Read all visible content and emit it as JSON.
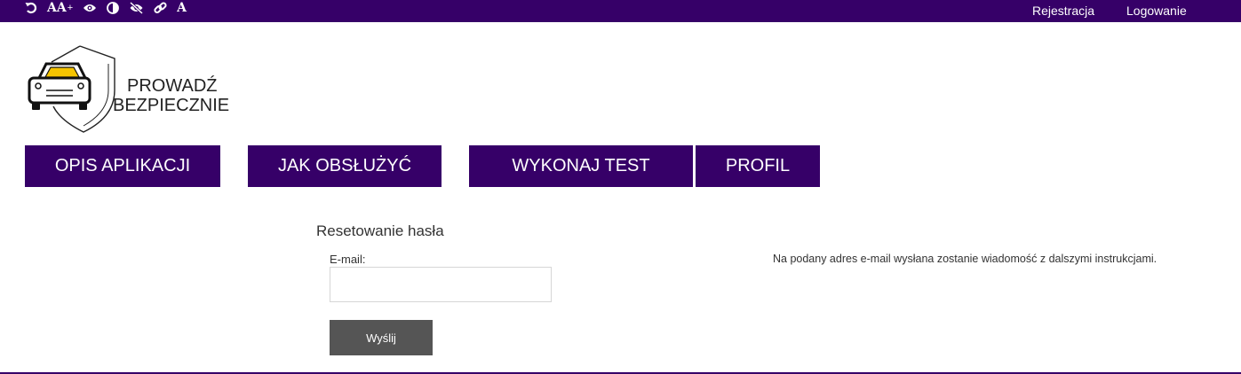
{
  "accessibility_toolbar": {
    "icons": [
      "reset-icon",
      "font-size-icon",
      "eye-icon",
      "contrast-icon",
      "eye-slash-icon",
      "link-icon",
      "font-icon"
    ],
    "font_size_label": "AA",
    "font_size_plus": "+",
    "font_label": "A"
  },
  "header": {
    "register_link": "Rejestracja",
    "login_link": "Logowanie"
  },
  "logo": {
    "line1": "PROWADŹ",
    "line2": "BEZPIECZNIE"
  },
  "nav": {
    "items": [
      {
        "label": "OPIS APLIKACJI"
      },
      {
        "label": "JAK OBSŁUŻYĆ"
      },
      {
        "label": "WYKONAJ TEST"
      },
      {
        "label": "PROFIL"
      }
    ]
  },
  "reset_form": {
    "title": "Resetowanie hasła",
    "email_label": "E-mail:",
    "email_value": "",
    "submit_label": "Wyślij",
    "info": "Na podany adres e-mail wysłana zostanie wiadomość z dalszymi instrukcjami."
  },
  "colors": {
    "brand_purple": "#360068",
    "button_gray": "#555555",
    "car_yellow": "#f5c400"
  }
}
